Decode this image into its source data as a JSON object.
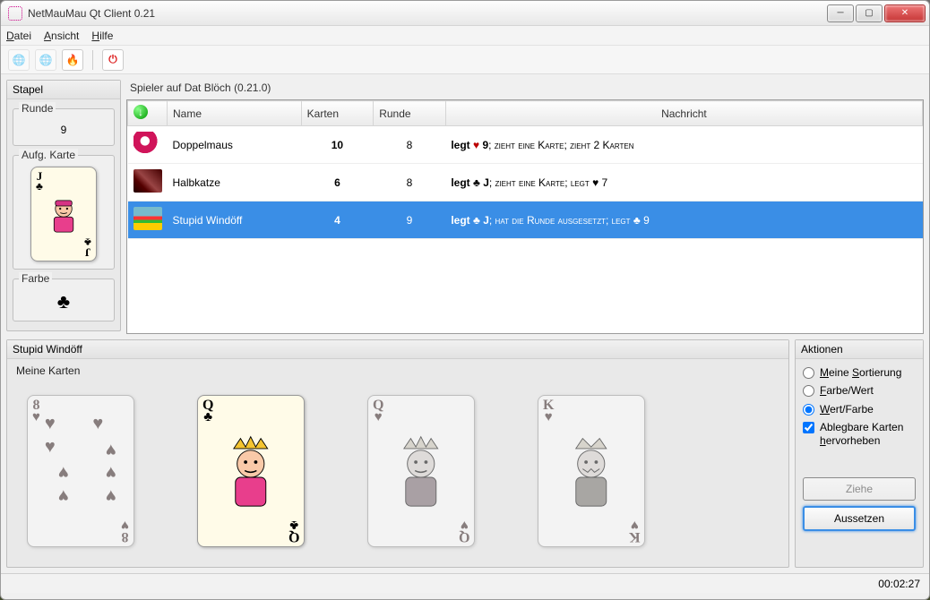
{
  "window": {
    "title": "NetMauMau Qt Client 0.21"
  },
  "menu": {
    "file": "Datei",
    "view": "Ansicht",
    "help": "Hilfe"
  },
  "sidebar": {
    "stack_header": "Stapel",
    "round_label": "Runde",
    "round_value": "9",
    "upcard_label": "Aufg. Karte",
    "upcard": {
      "rank": "J",
      "suit": "♣",
      "suit_name": "clubs"
    },
    "farbe_label": "Farbe",
    "farbe_suit": "♣"
  },
  "players_panel": {
    "title": "Spieler auf Dat Blöch (0.21.0)",
    "columns": {
      "icon": "",
      "name": "Name",
      "cards": "Karten",
      "round": "Runde",
      "message": "Nachricht"
    },
    "rows": [
      {
        "avatar": "av0",
        "name": "Doppelmaus",
        "cards": "10",
        "round": "8",
        "msg_lead": "legt ",
        "msg_suit": "♥",
        "msg_val": " 9",
        "msg_tail": "; zieht eine Karte; zieht 2 Karten",
        "selected": false
      },
      {
        "avatar": "av1",
        "name": "Halbkatze",
        "cards": "6",
        "round": "8",
        "msg_lead": "legt ",
        "msg_suit": "♣",
        "msg_val": " J",
        "msg_tail": "; zieht eine Karte; legt ♥ 7",
        "selected": false
      },
      {
        "avatar": "av2",
        "name": "Stupid Windöff",
        "cards": "4",
        "round": "9",
        "msg_lead": "legt ",
        "msg_suit": "♣",
        "msg_val": " J",
        "msg_tail": "; hat die Runde ausgesetzt; legt ♣ 9",
        "selected": true
      }
    ]
  },
  "hand_panel": {
    "header": "Stupid Windöff",
    "label": "Meine Karten",
    "cards": [
      {
        "rank": "8",
        "suit": "♥",
        "color": "#b00",
        "playable": false,
        "type": "pips"
      },
      {
        "rank": "Q",
        "suit": "♣",
        "color": "#000",
        "playable": true,
        "type": "queen"
      },
      {
        "rank": "Q",
        "suit": "♥",
        "color": "#b00",
        "playable": false,
        "type": "queen"
      },
      {
        "rank": "K",
        "suit": "♥",
        "color": "#b00",
        "playable": false,
        "type": "king"
      }
    ]
  },
  "actions": {
    "header": "Aktionen",
    "sort_mine": "Meine Sortierung",
    "sort_farbe_wert": "Farbe/Wert",
    "sort_wert_farbe": "Wert/Farbe",
    "highlight": "Ablegbare Karten hervorheben",
    "draw": "Ziehe",
    "pass": "Aussetzen"
  },
  "statusbar": {
    "time": "00:02:27"
  }
}
